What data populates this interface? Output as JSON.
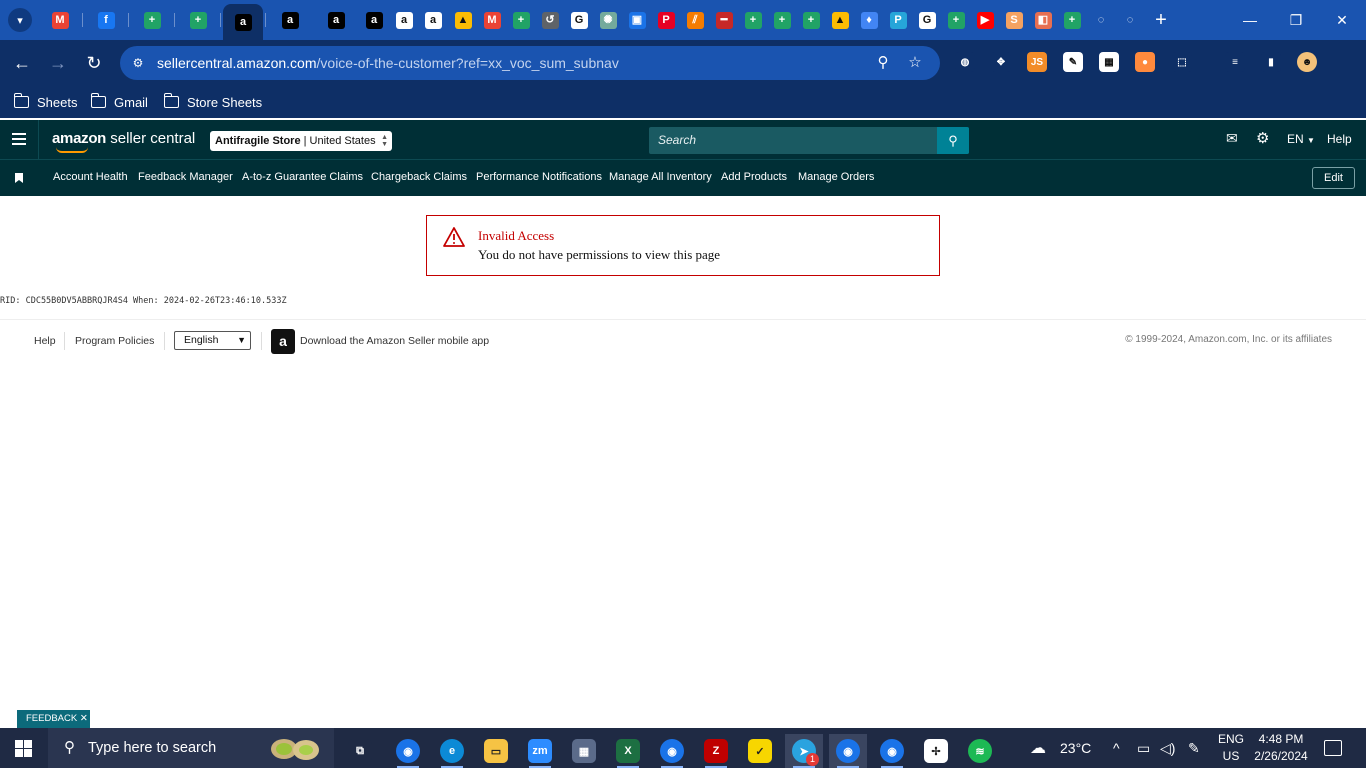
{
  "browser": {
    "tabs": [
      {
        "icon": "gmail-icon",
        "color": "#ea4335",
        "glyph": "M"
      },
      {
        "icon": "facebook-icon",
        "color": "#1877f2",
        "glyph": "f"
      },
      {
        "icon": "sheets-icon",
        "color": "#21a366",
        "glyph": "+"
      },
      {
        "icon": "sheets-icon",
        "color": "#21a366",
        "glyph": "+"
      },
      {
        "icon": "amazon-icon",
        "color": "#000000",
        "glyph": "a",
        "active": true
      },
      {
        "icon": "amazon-icon",
        "color": "#000000",
        "glyph": "a"
      },
      {
        "icon": "amazon-icon",
        "color": "#000000",
        "glyph": "a"
      },
      {
        "icon": "amazon-icon",
        "color": "#000000",
        "glyph": "a"
      },
      {
        "icon": "amazon-icon",
        "color": "#ffffff",
        "glyph": "a"
      },
      {
        "icon": "amazon-icon",
        "color": "#ffffff",
        "glyph": "a"
      },
      {
        "icon": "drive-icon",
        "color": "#fbbc04",
        "glyph": "▲"
      },
      {
        "icon": "gmail-icon",
        "color": "#ea4335",
        "glyph": "M"
      },
      {
        "icon": "sheets-icon",
        "color": "#21a366",
        "glyph": "+"
      },
      {
        "icon": "history-icon",
        "color": "#5f6368",
        "glyph": "↺"
      },
      {
        "icon": "google-icon",
        "color": "#ffffff",
        "glyph": "G"
      },
      {
        "icon": "chatgpt-icon",
        "color": "#74aa9c",
        "glyph": "✺"
      },
      {
        "icon": "bot-icon",
        "color": "#1a73e8",
        "glyph": "▣"
      },
      {
        "icon": "pinterest-icon",
        "color": "#e60023",
        "glyph": "P"
      },
      {
        "icon": "slash-icon",
        "color": "#f57c00",
        "glyph": "⫽"
      },
      {
        "icon": "redbar-icon",
        "color": "#c62828",
        "glyph": "━"
      },
      {
        "icon": "sheets-icon",
        "color": "#21a366",
        "glyph": "+"
      },
      {
        "icon": "sheets-icon",
        "color": "#21a366",
        "glyph": "+"
      },
      {
        "icon": "sheets-icon",
        "color": "#21a366",
        "glyph": "+"
      },
      {
        "icon": "drive-icon",
        "color": "#fbbc04",
        "glyph": "▲"
      },
      {
        "icon": "maps-pin-icon",
        "color": "#4285f4",
        "glyph": "♦"
      },
      {
        "icon": "p-icon",
        "color": "#26a5d9",
        "glyph": "P"
      },
      {
        "icon": "google-icon",
        "color": "#ffffff",
        "glyph": "G"
      },
      {
        "icon": "sheets-icon",
        "color": "#21a366",
        "glyph": "+"
      },
      {
        "icon": "youtube-icon",
        "color": "#ff0000",
        "glyph": "▶"
      },
      {
        "icon": "sas-icon",
        "color": "#f4a261",
        "glyph": "S"
      },
      {
        "icon": "shop-icon",
        "color": "#e76f51",
        "glyph": "◧"
      },
      {
        "icon": "sheets-icon",
        "color": "#21a366",
        "glyph": "+"
      },
      {
        "icon": "loading-icon",
        "color": "#1a54b0",
        "glyph": "◌"
      },
      {
        "icon": "loading-icon",
        "color": "#1a54b0",
        "glyph": "◌"
      }
    ],
    "url_host": "sellercentral.amazon.com",
    "url_path": "/voice-of-the-customer?ref=xx_voc_sum_subnav",
    "bookmarks": [
      "Sheets",
      "Gmail",
      "Store Sheets"
    ],
    "extensions": [
      {
        "icon": "globe-icon",
        "color": "#0e2f66",
        "glyph": "◍"
      },
      {
        "icon": "puzzle-move-icon",
        "color": "#0e2f66",
        "glyph": "✥"
      },
      {
        "icon": "js-icon",
        "color": "#f28c28",
        "glyph": "JS"
      },
      {
        "icon": "sign-icon",
        "color": "#ffffff",
        "glyph": "✎"
      },
      {
        "icon": "qr-icon",
        "color": "#ffffff",
        "glyph": "▦"
      },
      {
        "icon": "orange-circle-icon",
        "color": "#ff8a3d",
        "glyph": "●"
      },
      {
        "icon": "extensions-icon",
        "color": "#0e2f66",
        "glyph": "⬚"
      },
      {
        "icon": "media-icon",
        "color": "#0e2f66",
        "glyph": "≡"
      },
      {
        "icon": "sidepanel-icon",
        "color": "#0e2f66",
        "glyph": "▮"
      },
      {
        "icon": "profile-avatar-icon",
        "color": "#f4c27a",
        "glyph": "☻"
      }
    ]
  },
  "seller_central": {
    "logo_word": "amazon",
    "logo_suffix": "seller central",
    "store_name": "Antifragile Store",
    "store_region": "| United States",
    "search_placeholder": "Search",
    "language": "EN",
    "help": "Help",
    "shortcuts": [
      "Account Health",
      "Feedback Manager",
      "A-to-z Guarantee Claims",
      "Chargeback Claims",
      "Performance Notifications",
      "Manage All Inventory",
      "Add Products",
      "Manage Orders"
    ],
    "edit_label": "Edit"
  },
  "alert": {
    "title": "Invalid Access",
    "message": "You do not have permissions to view this page",
    "color": "#c40000"
  },
  "rid_line": "RID: CDC55B0DV5ABBRQJR4S4 When: 2024-02-26T23:46:10.533Z",
  "footer": {
    "help": "Help",
    "program_policies": "Program Policies",
    "language_value": "English",
    "app_download": "Download the Amazon Seller mobile app",
    "copyright": "© 1999-2024, Amazon.com, Inc. or its affiliates"
  },
  "feedback_label": "FEEDBACK ✕",
  "taskbar": {
    "search_placeholder": "Type here to search",
    "apps": [
      {
        "icon": "taskview-icon",
        "color": "#1f2a44",
        "glyph": "⧉"
      },
      {
        "icon": "chrome-icon",
        "color": "#1a73e8",
        "glyph": "◉"
      },
      {
        "icon": "edge-icon",
        "color": "#0c8ad6",
        "glyph": "e"
      },
      {
        "icon": "file-explorer-icon",
        "color": "#f6c344",
        "glyph": "▭"
      },
      {
        "icon": "zoom-icon",
        "color": "#2d8cff",
        "glyph": "zm"
      },
      {
        "icon": "calculator-icon",
        "color": "#5b6b8a",
        "glyph": "▦"
      },
      {
        "icon": "excel-icon",
        "color": "#1d6f42",
        "glyph": "X"
      },
      {
        "icon": "chrome-profile-icon",
        "color": "#1a73e8",
        "glyph": "◉"
      },
      {
        "icon": "filezilla-icon",
        "color": "#bf0000",
        "glyph": "Z"
      },
      {
        "icon": "sticky-notes-icon",
        "color": "#f7d600",
        "glyph": "✓"
      },
      {
        "icon": "telegram-icon",
        "color": "#2aa3df",
        "glyph": "➤"
      },
      {
        "icon": "chrome-profile-icon",
        "color": "#1a73e8",
        "glyph": "◉"
      },
      {
        "icon": "chrome-profile-icon",
        "color": "#1a73e8",
        "glyph": "◉"
      },
      {
        "icon": "slack-icon",
        "color": "#ffffff",
        "glyph": "✢"
      },
      {
        "icon": "spotify-icon",
        "color": "#1db954",
        "glyph": "≋"
      }
    ],
    "telegram_badge": "1",
    "weather": "23°C",
    "lang_line1": "ENG",
    "lang_line2": "US",
    "time": "4:48 PM",
    "date": "2/26/2024"
  }
}
